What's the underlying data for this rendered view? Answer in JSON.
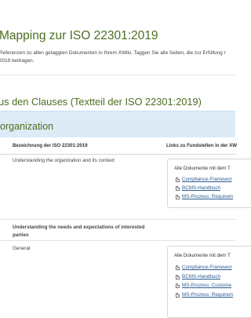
{
  "page": {
    "title": "Mapping zur ISO 22301:2019",
    "intro_line1": "Referenzen zu allen getaggten Dokumenten in Ihrem XWiki. Taggen Sie alle Seiten, die zur Erfüllung r",
    "intro_line2": "2019 beitragen."
  },
  "section": {
    "title": "us den Clauses (Textteil der ISO 22301:2019)",
    "group_label": "organization"
  },
  "table": {
    "col1_header": "Bezeichnung der ISO 22301:2019",
    "col2_header": "Links zu Fundstellen in der XW",
    "rows": [
      {
        "label": "Understanding the organization and its context",
        "box_header": "Alle Dokumente mit dem T",
        "links": [
          "Compliance-Framewor",
          "BCMS-Handbuch",
          "MS-Prozess: Requirem"
        ]
      },
      {
        "label": "Understanding the needs and expectations of interested parties"
      },
      {
        "label": "General",
        "box_header": "Alle Dokumente mit dem T",
        "links": [
          "Compliance-Framewor",
          "BCMS-Handbuch",
          "MS-Prozess: Custome",
          "MS-Prozess: Requirem"
        ]
      }
    ]
  }
}
